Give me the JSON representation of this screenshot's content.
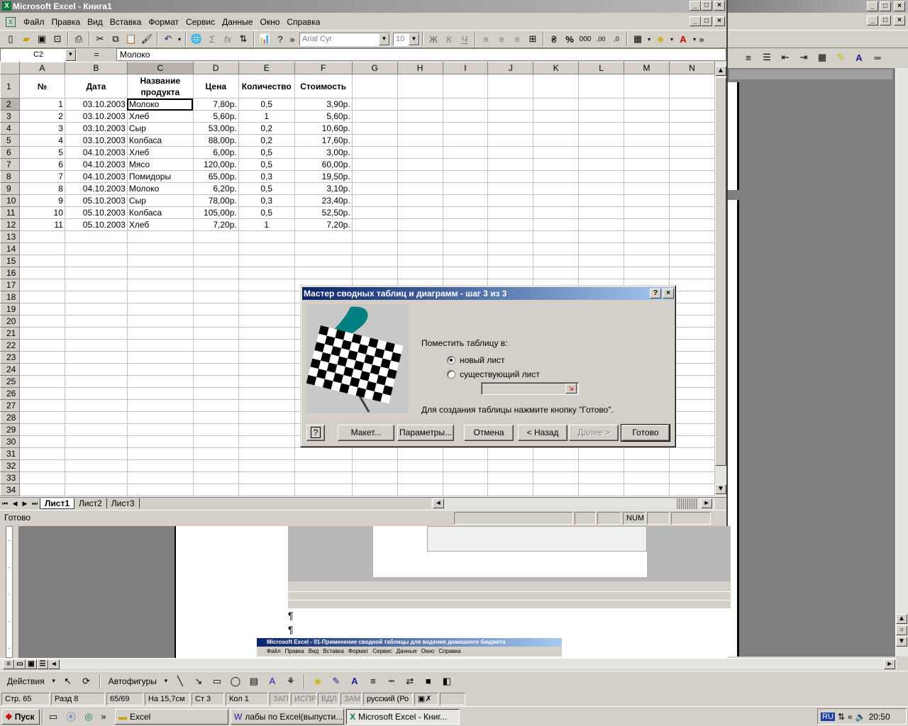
{
  "excel": {
    "title": "Microsoft Excel - Книга1",
    "menu": [
      "Файл",
      "Правка",
      "Вид",
      "Вставка",
      "Формат",
      "Сервис",
      "Данные",
      "Окно",
      "Справка"
    ],
    "font_name": "Arial Cyr",
    "font_size": "10",
    "name_box": "C2",
    "formula_eq": "=",
    "formula_value": "Молоко",
    "columns": [
      "A",
      "B",
      "C",
      "D",
      "E",
      "F",
      "G",
      "H",
      "I",
      "J",
      "K",
      "L",
      "M",
      "N"
    ],
    "header_row": [
      "№",
      "Дата",
      "Название продукта",
      "Цена",
      "Количество",
      "Стоимость"
    ],
    "rows": [
      [
        "1",
        "03.10.2003",
        "Молоко",
        "7,80р.",
        "0,5",
        "3,90р."
      ],
      [
        "2",
        "03.10.2003",
        "Хлеб",
        "5,60р.",
        "1",
        "5,60р."
      ],
      [
        "3",
        "03.10.2003",
        "Сыр",
        "53,00р.",
        "0,2",
        "10,60р."
      ],
      [
        "4",
        "03.10.2003",
        "Колбаса",
        "88,00р.",
        "0,2",
        "17,60р."
      ],
      [
        "5",
        "04.10.2003",
        "Хлеб",
        "6,00р.",
        "0,5",
        "3,00р."
      ],
      [
        "6",
        "04.10.2003",
        "Мясо",
        "120,00р.",
        "0,5",
        "60,00р."
      ],
      [
        "7",
        "04.10.2003",
        "Помидоры",
        "65,00р.",
        "0,3",
        "19,50р."
      ],
      [
        "8",
        "04.10.2003",
        "Молоко",
        "6,20р.",
        "0,5",
        "3,10р."
      ],
      [
        "9",
        "05.10.2003",
        "Сыр",
        "78,00р.",
        "0,3",
        "23,40р."
      ],
      [
        "10",
        "05.10.2003",
        "Колбаса",
        "105,00р.",
        "0,5",
        "52,50р."
      ],
      [
        "11",
        "05.10.2003",
        "Хлеб",
        "7,20р.",
        "1",
        "7,20р."
      ]
    ],
    "sheet_tabs": [
      "Лист1",
      "Лист2",
      "Лист3"
    ],
    "status": "Готово",
    "status_num": "NUM"
  },
  "dialog": {
    "title": "Мастер сводных таблиц и диаграмм - шаг 3 из 3",
    "help_glyph": "?",
    "close_glyph": "×",
    "place_label": "Поместить таблицу в:",
    "radio_new": "новый лист",
    "radio_existing": "существующий лист",
    "hint": "Для создания таблицы нажмите кнопку \"Готово\".",
    "btn_layout": "Макет...",
    "btn_params": "Параметры...",
    "btn_cancel": "Отмена",
    "btn_back": "< Назад",
    "btn_next": "Далее >",
    "btn_finish": "Готово",
    "selected_option": "new_sheet"
  },
  "word": {
    "drawing_toolbar": {
      "actions": "Действия",
      "autoshapes": "Автофигуры"
    },
    "status": {
      "page": "Стр. 65",
      "section": "Разд 8",
      "pages": "65/69",
      "at": "На 15,7см",
      "line": "Ст 3",
      "col": "Кол 1",
      "rec": "ЗАП",
      "trk": "ИСПР",
      "ext": "ВДЛ",
      "ovr": "ЗАМ",
      "lang": "русский (Ро"
    },
    "embedded_caption": "Microsoft Excel - 01-Применение сводной таблицы для ведения домашнего бюджета",
    "embedded_menu": [
      "Файл",
      "Правка",
      "Вид",
      "Вставка",
      "Формат",
      "Сервис",
      "Данные",
      "Окно",
      "Справка"
    ]
  },
  "taskbar": {
    "start": "Пуск",
    "tasks": [
      "Excel",
      "лабы по Excel(выпусти...",
      "Microsoft Excel - Книг..."
    ],
    "active_task_index": 2,
    "lang": "RU",
    "time": "20:50"
  },
  "colors": {
    "title_active": "#0a246a",
    "title_inactive": "#808080",
    "face": "#d4d0c8",
    "teal_logo": "#008080"
  }
}
